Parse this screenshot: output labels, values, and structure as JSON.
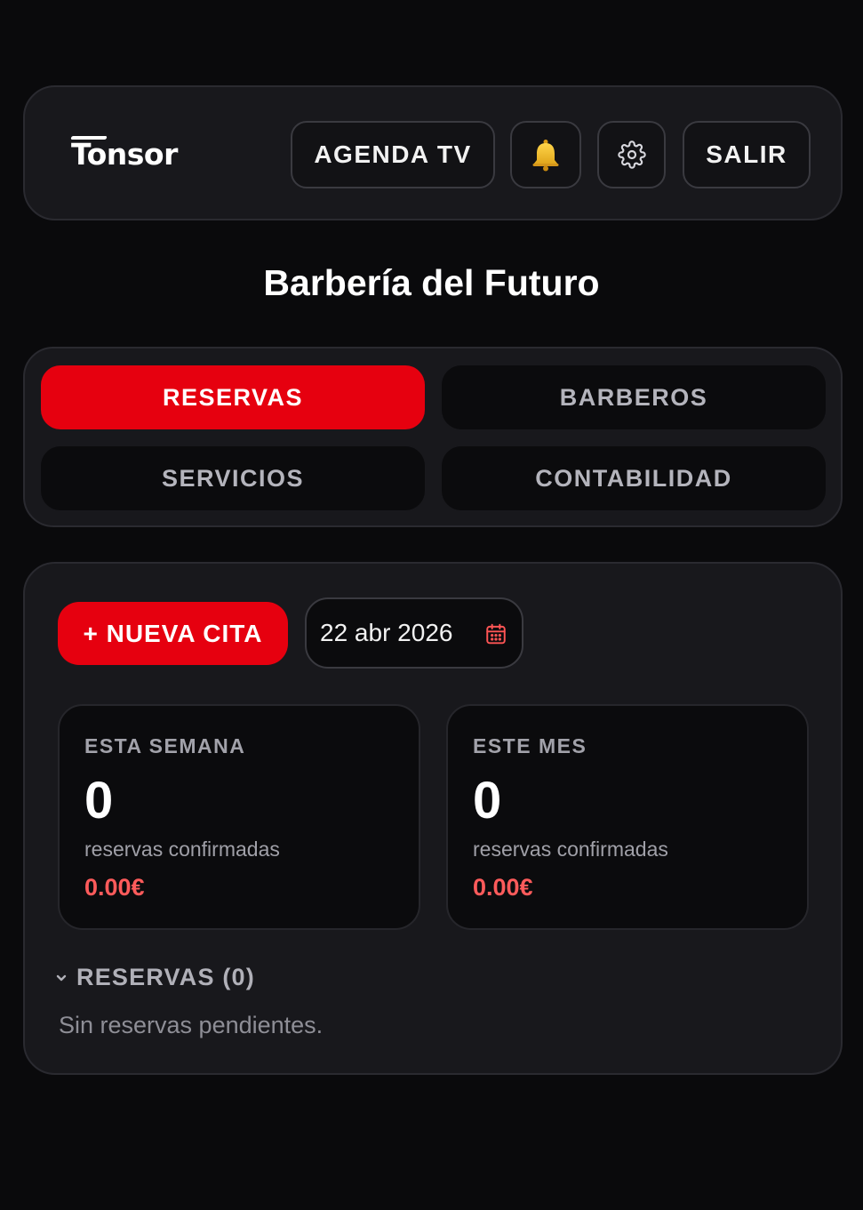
{
  "header": {
    "logo": "Tonsor",
    "agenda_label": "AGENDA TV",
    "bell_icon": "bell-icon",
    "gear_icon": "gear-icon",
    "logout_label": "SALIR"
  },
  "page": {
    "title": "Barbería del Futuro"
  },
  "tabs": [
    {
      "label": "RESERVAS",
      "active": true
    },
    {
      "label": "BARBEROS",
      "active": false
    },
    {
      "label": "SERVICIOS",
      "active": false
    },
    {
      "label": "CONTABILIDAD",
      "active": false
    }
  ],
  "toolbar": {
    "new_label": "+ NUEVA CITA",
    "date_value": "22 abr 2026",
    "calendar_icon": "calendar-icon"
  },
  "stats": [
    {
      "label": "ESTA SEMANA",
      "count": "0",
      "sub": "reservas confirmadas",
      "amount": "0.00€"
    },
    {
      "label": "ESTE MES",
      "count": "0",
      "sub": "reservas confirmadas",
      "amount": "0.00€"
    }
  ],
  "reservations": {
    "title": "RESERVAS (0)",
    "empty_text": "Sin reservas pendientes."
  },
  "colors": {
    "background": "#0a0a0c",
    "card": "#18181c",
    "accent": "#e6000f",
    "amount": "#ff5b5b"
  }
}
